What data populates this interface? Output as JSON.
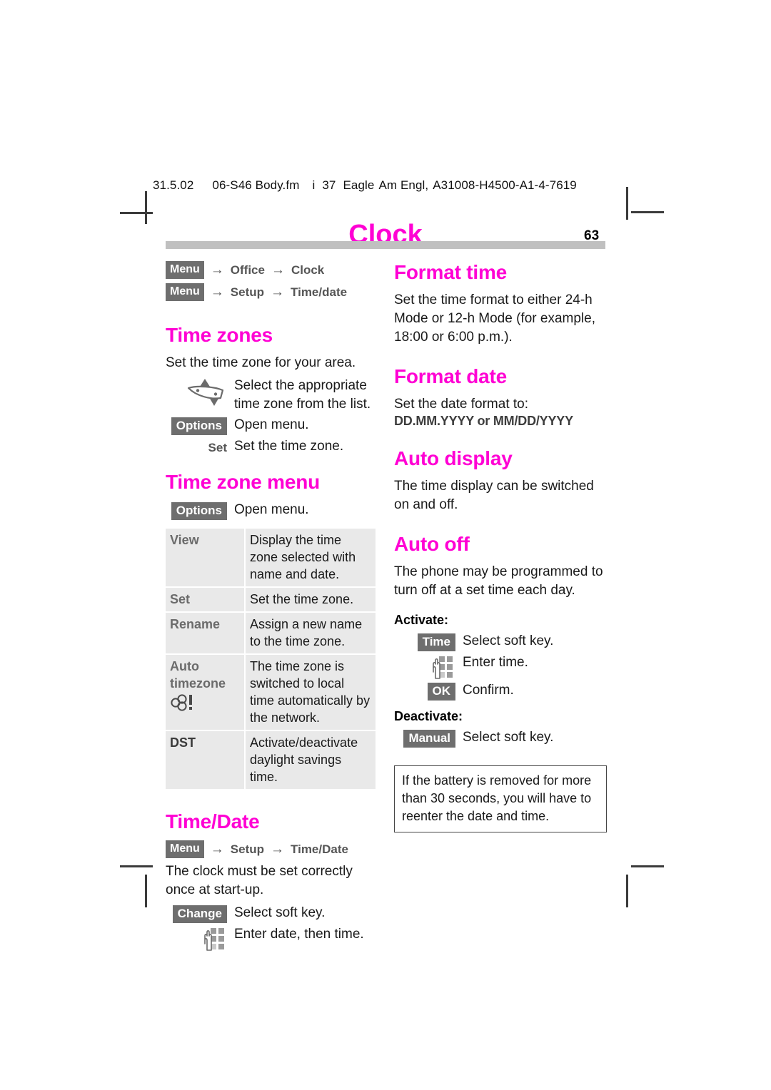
{
  "running_head": {
    "date": "31.5.02",
    "file": "06-S46 Body.fm",
    "i": "i",
    "num": "37",
    "eagle": "Eagle",
    "lang": "Am Engl,",
    "doc_id": "A31008-H4500-A1-4-7619"
  },
  "header": {
    "chapter_title": "Clock",
    "page_number": "63",
    "rule_color": "#c0c0c0",
    "accent_color": "#ff00d4"
  },
  "left_column": {
    "nav_paths": [
      {
        "key": "Menu",
        "arrow": "→",
        "step1": "Office",
        "arrow2": "→",
        "step2": "Clock"
      },
      {
        "key": "Menu",
        "arrow": "→",
        "step1": "Setup",
        "arrow2": "→",
        "step2": "Time/date"
      }
    ],
    "time_zones": {
      "heading": "Time zones",
      "intro": "Set the time zone for your area.",
      "steps": [
        {
          "icon": "navigation-key-icon",
          "key": "",
          "key_style": "icon",
          "desc": "Select the appropriate time zone from the list."
        },
        {
          "icon": "",
          "key": "Options",
          "key_style": "softkey",
          "desc": "Open menu."
        },
        {
          "icon": "",
          "key": "Set",
          "key_style": "plain",
          "desc": "Set the time zone."
        }
      ]
    },
    "time_zone_menu": {
      "heading": "Time zone menu",
      "steps": [
        {
          "icon": "",
          "key": "Options",
          "key_style": "softkey",
          "desc": "Open menu."
        }
      ],
      "table": {
        "rows": [
          {
            "key": "View",
            "key_icon": "",
            "value": "Display the time zone selected with name and date."
          },
          {
            "key": "Set",
            "key_icon": "",
            "value": "Set the time zone."
          },
          {
            "key": "Rename",
            "key_icon": "",
            "value": "Assign a new name to the time zone."
          },
          {
            "key": "Auto timezone",
            "key_icon": "network-alert-icon",
            "value": "The time zone is switched to local time automatically by the network."
          },
          {
            "key": "DST",
            "key_icon": "",
            "value": "Activate/deactivate daylight savings time."
          }
        ]
      }
    },
    "time_date": {
      "heading": "Time/Date",
      "nav_path": {
        "key": "Menu",
        "arrow": "→",
        "step1": "Setup",
        "arrow2": "→",
        "step2": "Time/Date"
      },
      "intro": "The clock must be set correctly once at start-up.",
      "steps": [
        {
          "icon": "",
          "key": "Change",
          "key_style": "softkey",
          "desc": "Select soft key."
        },
        {
          "icon": "keypad-hand-icon",
          "key": "",
          "key_style": "icon",
          "desc": "Enter date, then time."
        }
      ]
    }
  },
  "right_column": {
    "format_time": {
      "heading": "Format time",
      "body": "Set the time format to either 24-h Mode or 12-h Mode (for example, 18:00 or 6:00 p.m.)."
    },
    "format_date": {
      "heading": "Format date",
      "body": "Set the date format to:",
      "formats": "DD.MM.YYYY or MM/DD/YYYY"
    },
    "auto_display": {
      "heading": "Auto display",
      "body": "The time display can be switched on and off."
    },
    "auto_off": {
      "heading": "Auto off",
      "body": "The phone may be programmed to turn off at a set time each day.",
      "activate_label": "Activate:",
      "activate_steps": [
        {
          "icon": "",
          "key": "Time",
          "key_style": "softkey",
          "desc": "Select soft key."
        },
        {
          "icon": "keypad-hand-icon",
          "key": "",
          "key_style": "icon",
          "desc": "Enter time."
        },
        {
          "icon": "",
          "key": "OK",
          "key_style": "softkey",
          "desc": "Confirm."
        }
      ],
      "deactivate_label": "Deactivate:",
      "deactivate_steps": [
        {
          "icon": "",
          "key": "Manual",
          "key_style": "softkey",
          "desc": "Select soft key."
        }
      ]
    },
    "note": "If the battery is removed for more than 30 seconds, you will have to reenter the date and time."
  }
}
